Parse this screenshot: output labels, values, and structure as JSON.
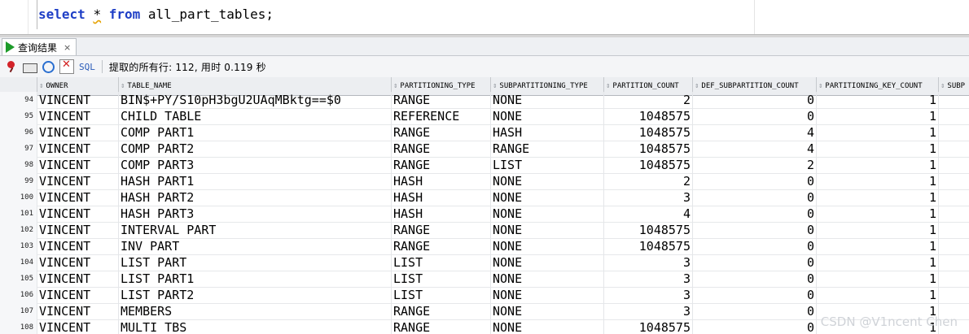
{
  "editor": {
    "kw_select": "select",
    "star": "*",
    "kw_from": "from",
    "table": "all_part_tables;"
  },
  "result_tab": {
    "label": "查询结果",
    "close": "×"
  },
  "toolbar": {
    "sql_label": "SQL",
    "fetch_status": "提取的所有行: 112, 用时 0.119 秒"
  },
  "columns": [
    "OWNER",
    "TABLE_NAME",
    "PARTITIONING_TYPE",
    "SUBPARTITIONING_TYPE",
    "PARTITION_COUNT",
    "DEF_SUBPARTITION_COUNT",
    "PARTITIONING_KEY_COUNT",
    "SUBP"
  ],
  "rows": [
    [
      "94",
      "VINCENT",
      "BIN$+PY/S10pH3bgU2UAqMBktg==$0",
      "RANGE",
      "NONE",
      "2",
      "0",
      "1"
    ],
    [
      "95",
      "VINCENT",
      "CHILD TABLE",
      "REFERENCE",
      "NONE",
      "1048575",
      "0",
      "1"
    ],
    [
      "96",
      "VINCENT",
      "COMP PART1",
      "RANGE",
      "HASH",
      "1048575",
      "4",
      "1"
    ],
    [
      "97",
      "VINCENT",
      "COMP PART2",
      "RANGE",
      "RANGE",
      "1048575",
      "4",
      "1"
    ],
    [
      "98",
      "VINCENT",
      "COMP PART3",
      "RANGE",
      "LIST",
      "1048575",
      "2",
      "1"
    ],
    [
      "99",
      "VINCENT",
      "HASH PART1",
      "HASH",
      "NONE",
      "2",
      "0",
      "1"
    ],
    [
      "100",
      "VINCENT",
      "HASH PART2",
      "HASH",
      "NONE",
      "3",
      "0",
      "1"
    ],
    [
      "101",
      "VINCENT",
      "HASH PART3",
      "HASH",
      "NONE",
      "4",
      "0",
      "1"
    ],
    [
      "102",
      "VINCENT",
      "INTERVAL PART",
      "RANGE",
      "NONE",
      "1048575",
      "0",
      "1"
    ],
    [
      "103",
      "VINCENT",
      "INV PART",
      "RANGE",
      "NONE",
      "1048575",
      "0",
      "1"
    ],
    [
      "104",
      "VINCENT",
      "LIST PART",
      "LIST",
      "NONE",
      "3",
      "0",
      "1"
    ],
    [
      "105",
      "VINCENT",
      "LIST PART1",
      "LIST",
      "NONE",
      "3",
      "0",
      "1"
    ],
    [
      "106",
      "VINCENT",
      "LIST PART2",
      "LIST",
      "NONE",
      "3",
      "0",
      "1"
    ],
    [
      "107",
      "VINCENT",
      "MEMBERS",
      "RANGE",
      "NONE",
      "3",
      "0",
      "1"
    ],
    [
      "108",
      "VINCENT",
      "MULTI TBS",
      "RANGE",
      "NONE",
      "1048575",
      "0",
      "1"
    ]
  ],
  "watermark": "CSDN @V1ncent Chen",
  "icons": [
    "pin-icon",
    "print-icon",
    "refresh-icon",
    "delete-icon",
    "play-icon",
    "sort-icon"
  ]
}
